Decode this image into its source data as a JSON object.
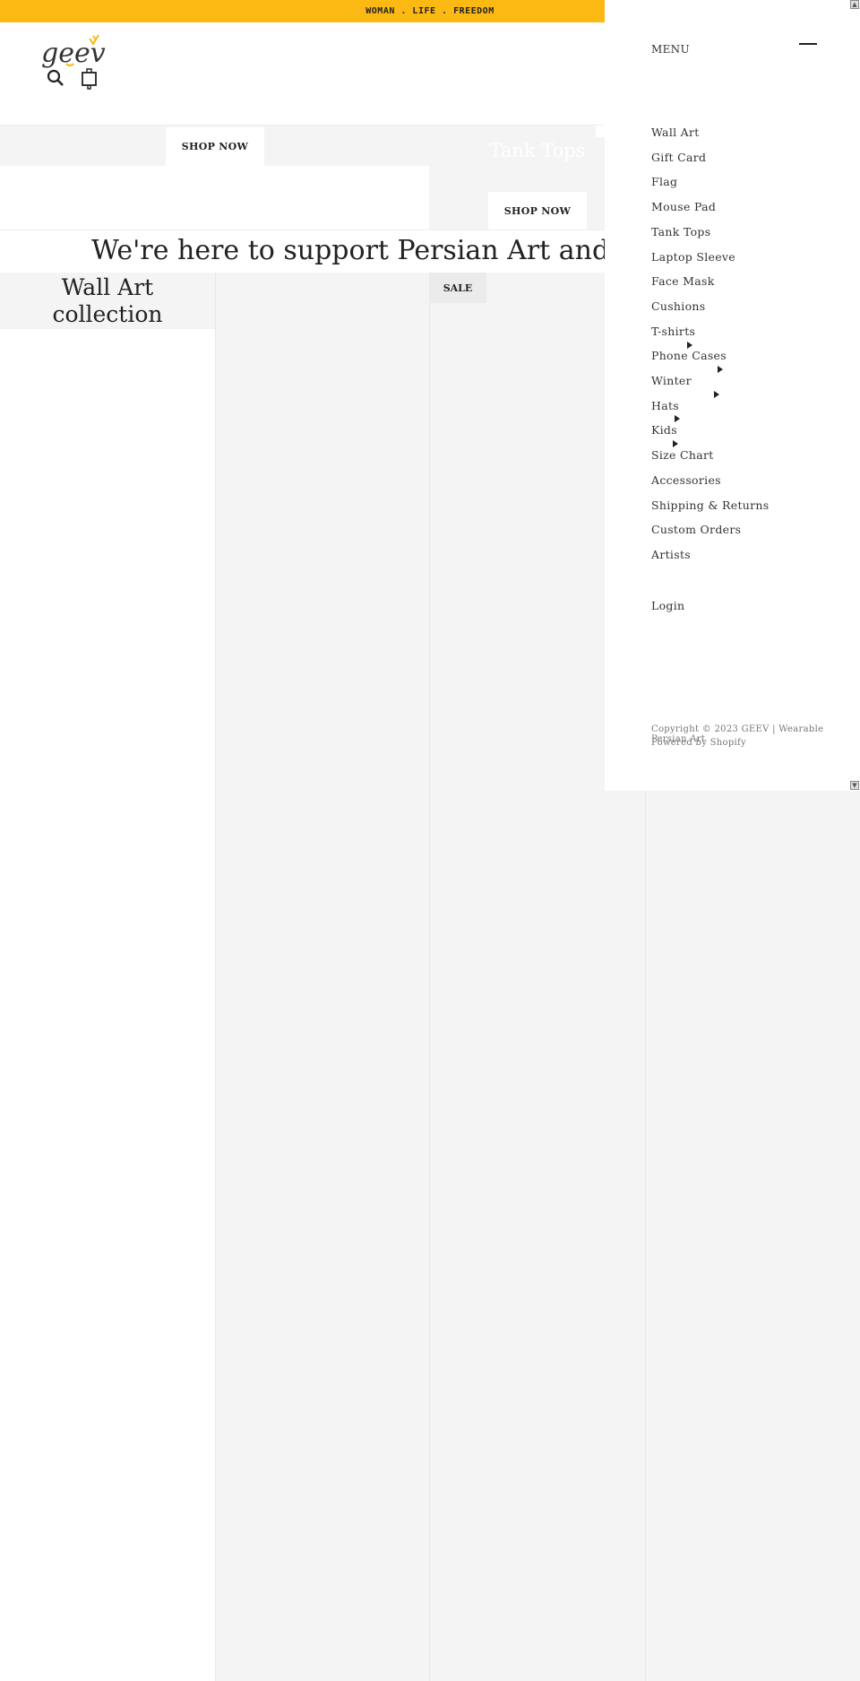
{
  "announcement": "WOMAN . LIFE . FREEDOM",
  "brand": {
    "logo_text": "geev",
    "accent": "#fdb913"
  },
  "header": {
    "icons": [
      "search-icon",
      "shopping-bag-icon"
    ]
  },
  "hero": {
    "shop_now_1": "SHOP NOW",
    "tank_tops_title": "Tank Tops",
    "shop_now_2": "SHOP NOW"
  },
  "headline": "We're here to support Persian Art and Pe",
  "collection": {
    "title_line1": "Wall Art",
    "title_line2": "collection",
    "sale_badge": "SALE"
  },
  "menu": {
    "title": "MENU",
    "items": [
      {
        "label": "Wall Art"
      },
      {
        "label": "Gift Card"
      },
      {
        "label": "Flag"
      },
      {
        "label": "Mouse Pad"
      },
      {
        "label": "Tank Tops"
      },
      {
        "label": "Laptop Sleeve"
      },
      {
        "label": "Face Mask"
      },
      {
        "label": "Cushions"
      },
      {
        "label": "T-shirts"
      },
      {
        "label": "Phone Cases"
      },
      {
        "label": "Winter"
      },
      {
        "label": "Hats"
      },
      {
        "label": "Kids"
      },
      {
        "label": "Size Chart"
      },
      {
        "label": "Accessories"
      },
      {
        "label": "Shipping & Returns"
      },
      {
        "label": "Custom Orders"
      },
      {
        "label": "Artists"
      }
    ],
    "login": "Login",
    "copyright": "Copyright © 2023 GEEV | Wearable Persian Art",
    "powered": "Powered by Shopify"
  }
}
